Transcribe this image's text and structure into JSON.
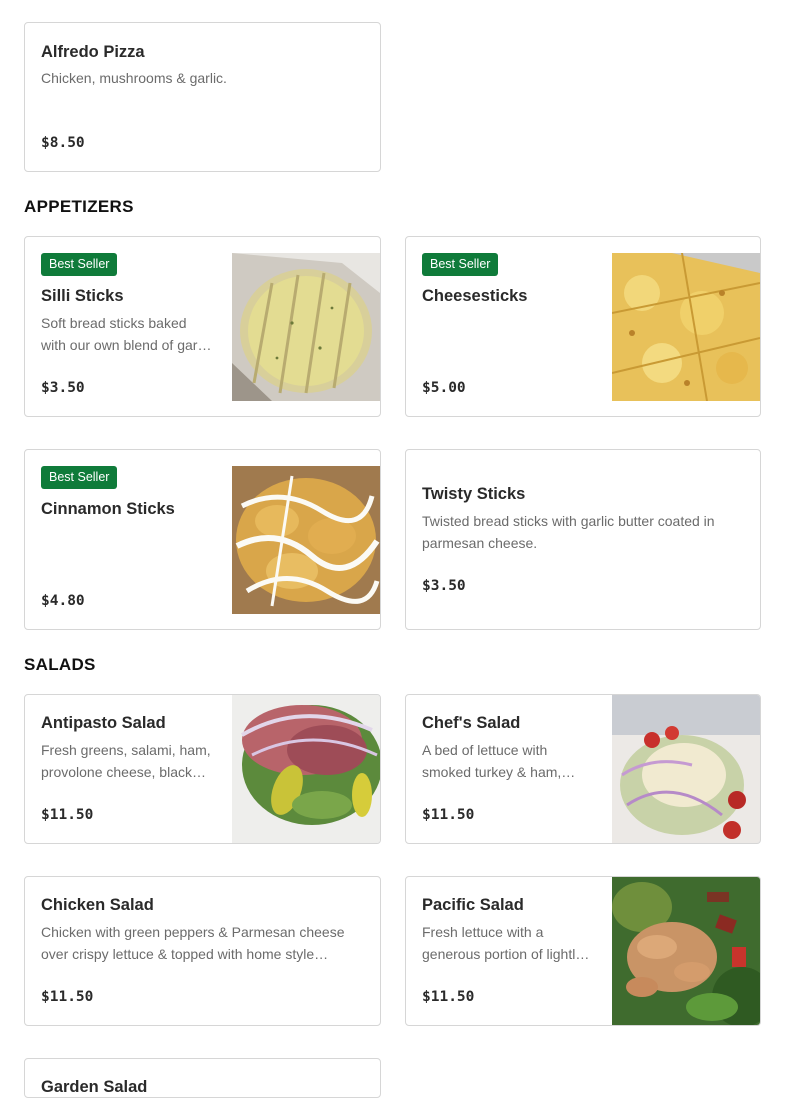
{
  "top_item": {
    "name": "Alfredo Pizza",
    "desc": "Chicken, mushrooms & garlic.",
    "price": "$8.50"
  },
  "sections": {
    "appetizers": {
      "title": "APPETIZERS",
      "items": [
        {
          "badge": "Best Seller",
          "name": "Silli Sticks",
          "desc": "Soft bread sticks baked with our own blend of garlic butter & parmesan cheese.",
          "price": "$3.50",
          "image": "garlic-breadsticks-photo"
        },
        {
          "badge": "Best Seller",
          "name": "Cheesesticks",
          "desc": "",
          "price": "$5.00",
          "image": "cheesesticks-photo"
        },
        {
          "badge": "Best Seller",
          "name": "Cinnamon Sticks",
          "desc": "",
          "price": "$4.80",
          "image": "cinnamon-sticks-photo"
        },
        {
          "name": "Twisty Sticks",
          "desc": "Twisted bread sticks with garlic butter coated in parmesan cheese.",
          "price": "$3.50"
        }
      ]
    },
    "salads": {
      "title": "SALADS",
      "items": [
        {
          "name": "Antipasto Salad",
          "desc": "Fresh greens, salami, ham, provolone cheese, black olives & pepperoncini.",
          "price": "$11.50",
          "image": "antipasto-salad-photo"
        },
        {
          "name": "Chef's Salad",
          "desc": "A bed of lettuce with smoked turkey & ham, cheese & tomatoes.",
          "price": "$11.50",
          "image": "chefs-salad-photo"
        },
        {
          "name": "Chicken Salad",
          "desc": "Chicken with green peppers & Parmesan cheese over crispy lettuce & topped with home style croutons.",
          "price": "$11.50"
        },
        {
          "name": "Pacific Salad",
          "desc": "Fresh lettuce with a generous portion of lightly seasoned chicken & bacon.",
          "price": "$11.50",
          "image": "pacific-salad-photo"
        },
        {
          "name": "Garden Salad"
        }
      ]
    }
  }
}
